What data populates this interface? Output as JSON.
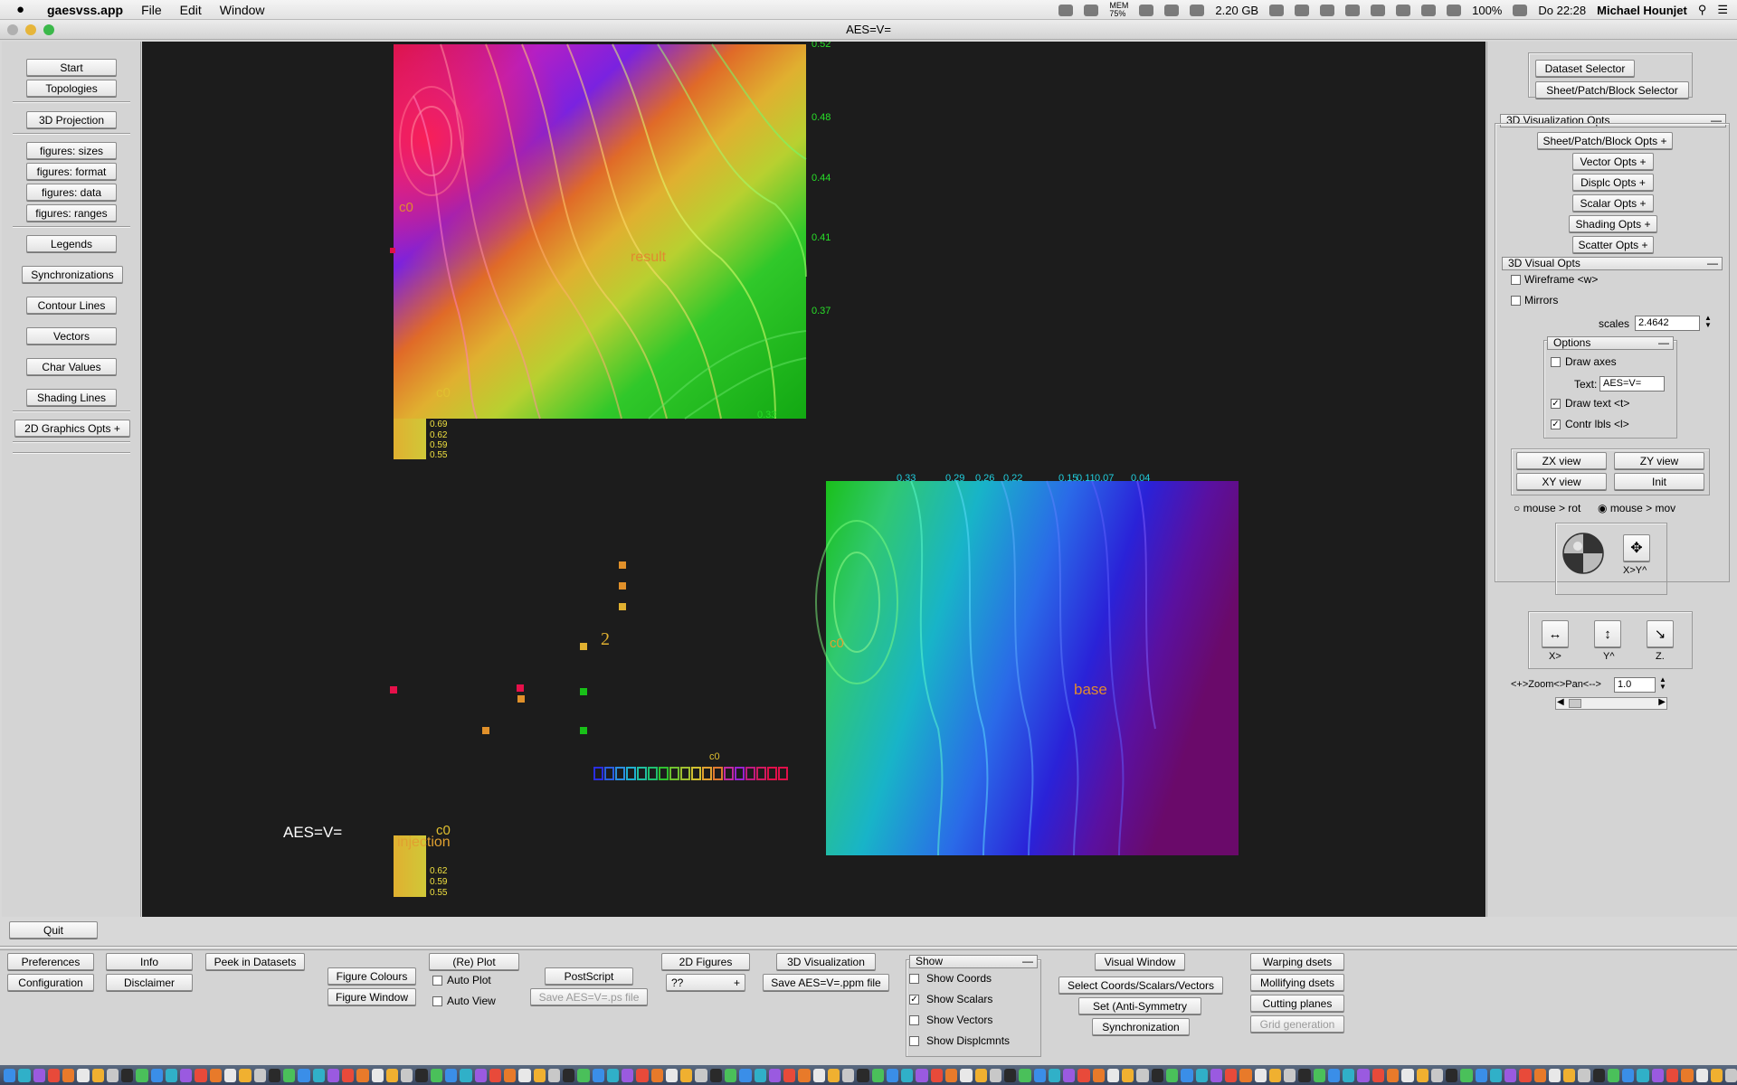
{
  "menubar": {
    "apple": "",
    "app": "gaesvss.app",
    "items": [
      "File",
      "Edit",
      "Window"
    ],
    "mem": "MEM\n75%",
    "memory": "2.20 GB",
    "battery": "100%",
    "clock": "Do 22:28",
    "user": "Michael Hounjet"
  },
  "window": {
    "title": "AES=V="
  },
  "left": {
    "start": "Start",
    "topologies": "Topologies",
    "projection": "3D Projection",
    "fig_sizes": "figures: sizes",
    "fig_format": "figures: format",
    "fig_data": "figures: data",
    "fig_ranges": "figures: ranges",
    "legends": "Legends",
    "sync": "Synchronizations",
    "contour": "Contour Lines",
    "vectors": "Vectors",
    "charvals": "Char Values",
    "shading": "Shading Lines",
    "gfx2d": "2D Graphics Opts  +",
    "quit": "Quit"
  },
  "canvas": {
    "label_c0": "c0",
    "label_result": "result",
    "label_base": "base",
    "label_injection": "injection",
    "label_2": "2",
    "aes_text": "AES=V=",
    "c0_row": "c0",
    "top_right_ticks": [
      "0.52",
      "0.48",
      "0.44",
      "0.41",
      "0.37",
      "0.33"
    ],
    "br_top_ticks": [
      "0.33",
      "0.29",
      "0.26",
      "0.22",
      "0.15",
      "0.11",
      "0.07",
      "0.04"
    ],
    "small_ticks": [
      "0.69",
      "0.62",
      "0.59",
      "0.55"
    ],
    "inj_ticks": [
      "0.62",
      "0.59",
      "0.55"
    ]
  },
  "right": {
    "dataset_selector": "Dataset Selector",
    "spb_selector": "Sheet/Patch/Block Selector",
    "vis3d": "3D Visualization Opts",
    "spb_opts": "Sheet/Patch/Block Opts  +",
    "vector_opts": "Vector  Opts  +",
    "displ_opts": "Displc  Opts  +",
    "scalar_opts": "Scalar  Opts  +",
    "shading_opts": "Shading  Opts  +",
    "scatter_opts": "Scatter Opts  +",
    "visual3d": "3D Visual Opts",
    "wireframe": "Wireframe <w>",
    "mirrors": "Mirrors",
    "scales_label": "scales",
    "scales_value": "2.4642",
    "options": "Options",
    "draw_axes": "Draw axes",
    "text_label": "Text:",
    "text_value": "AES=V=",
    "draw_text": "Draw  text <t>",
    "contr_lbls": "Contr lbls <l>",
    "zx": "ZX view",
    "zy": "ZY view",
    "xy": "XY view",
    "init": "Init",
    "mouse_rot": "mouse >  rot",
    "mouse_mov": "mouse >  mov",
    "xy_label": "X>Y^",
    "x_label": "X>",
    "y_label": "Y^",
    "z_label": "Z.",
    "zoom_label": "<+>Zoom<>Pan<-->",
    "zoom_value": "1.0"
  },
  "bottom": {
    "preferences": "Preferences",
    "configuration": "Configuration",
    "info": "Info",
    "disclaimer": "Disclaimer",
    "peek": "Peek in Datasets",
    "fig_colours": "Figure Colours",
    "fig_window": "Figure Window",
    "replot": "(Re) Plot",
    "auto_plot": "Auto Plot",
    "auto_view": "Auto View",
    "postscript": "PostScript",
    "save_ps": "Save AES=V=.ps file",
    "figs2d": "2D Figures",
    "qq": "??",
    "vis3d": "3D Visualization",
    "save_ppm": "Save AES=V=.ppm file",
    "show": "Show",
    "show_coords": "Show Coords",
    "show_scalars": "Show Scalars",
    "show_vectors": "Show Vectors",
    "show_displ": "Show Displcmnts",
    "visual_window": "Visual Window",
    "select_csv": "Select Coords/Scalars/Vectors",
    "set_anti": "Set    (Anti-Symmetry",
    "synchronization": "Synchronization",
    "warping": "Warping    dsets",
    "mollifying": "Mollifying dsets",
    "cutting": "Cutting planes",
    "grid_gen": "Grid generation"
  },
  "colors": {
    "magenta": "#c4157a",
    "red": "#e6104a",
    "purple": "#8a18e0",
    "orange": "#e0902a",
    "yellow": "#e8d028",
    "green": "#18c018",
    "blue": "#2a2ee0",
    "indigo": "#6a0a6a",
    "label": "#e08a30"
  }
}
